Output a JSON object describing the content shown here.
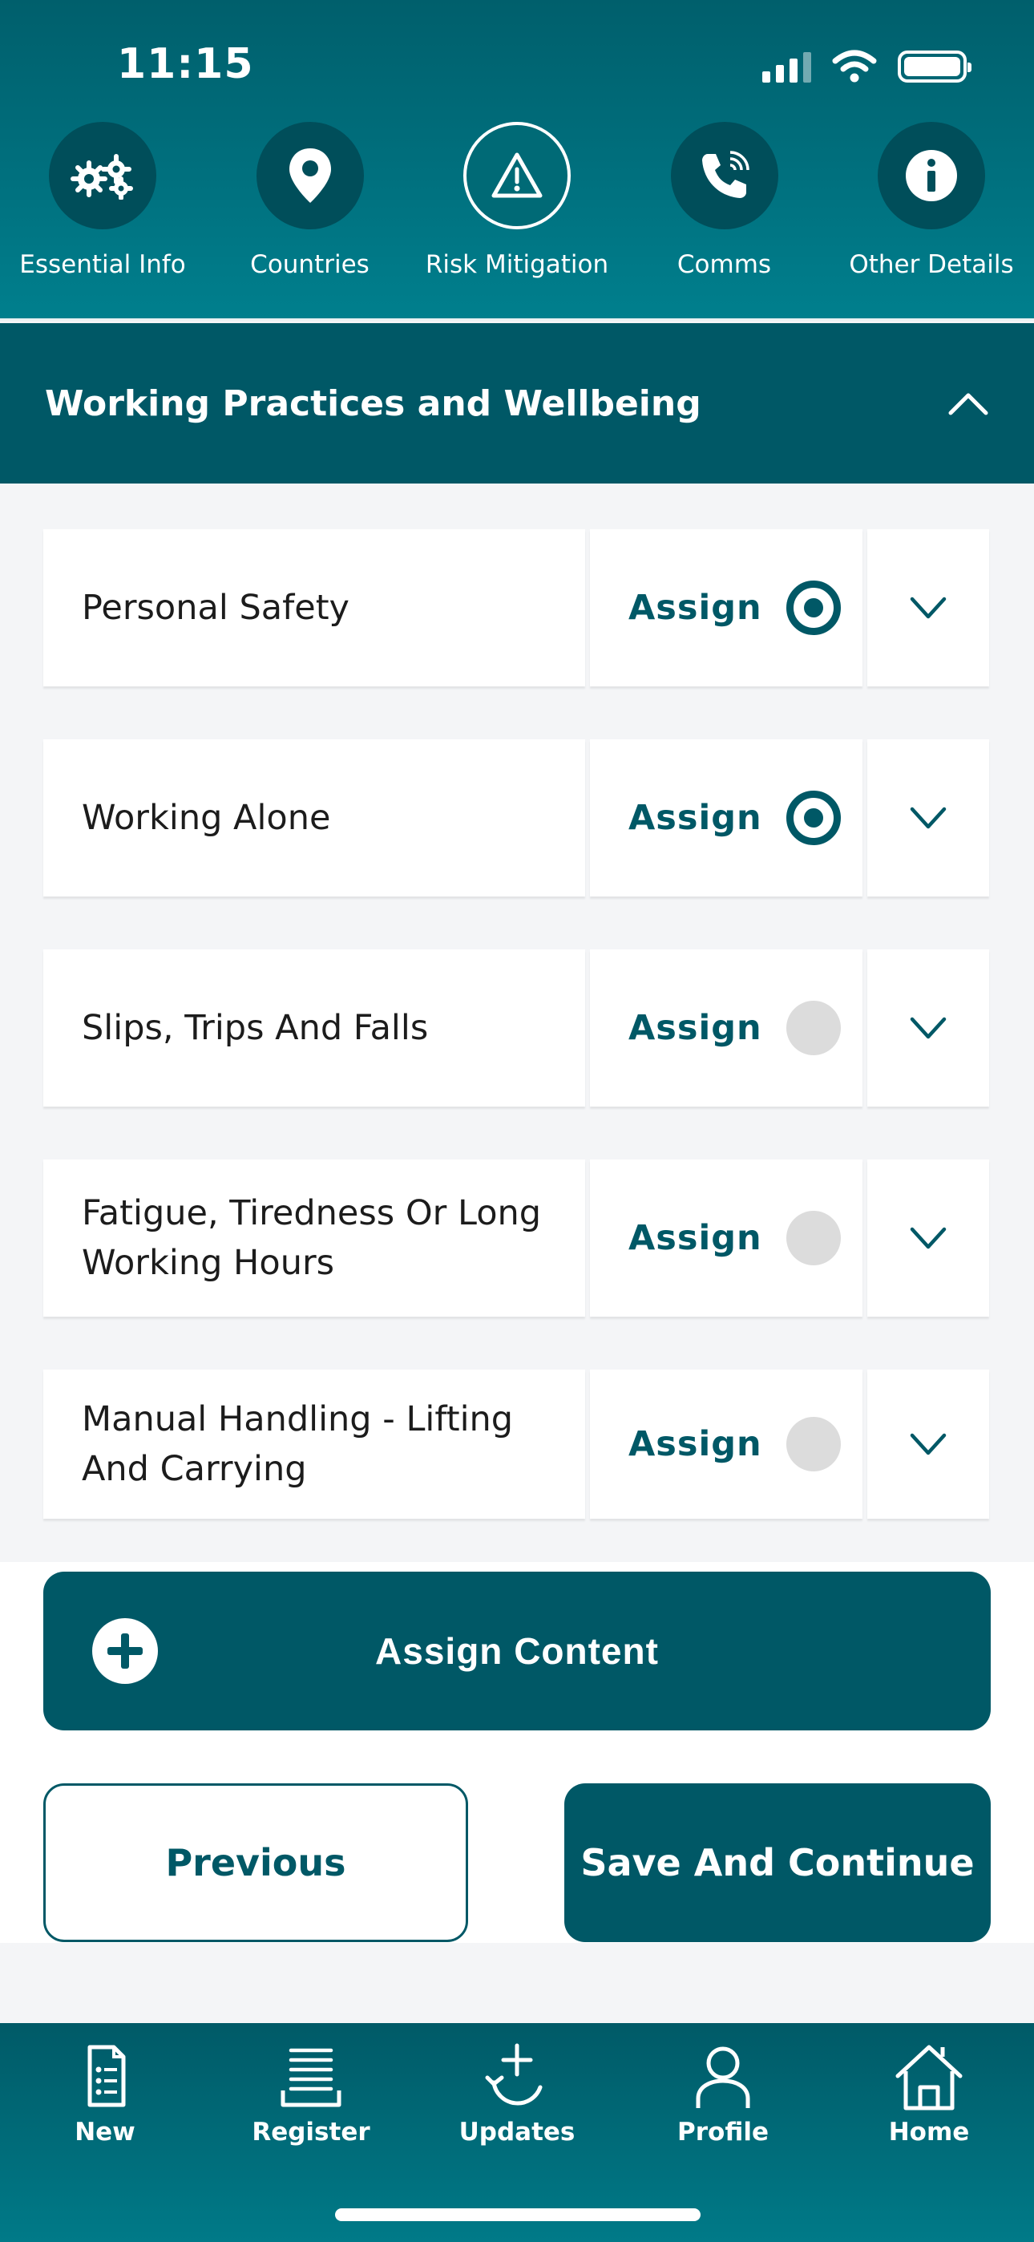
{
  "status_bar": {
    "time": "11:15"
  },
  "steps": [
    {
      "label": "Essential Info",
      "icon": "gears-icon",
      "active": false
    },
    {
      "label": "Countries",
      "icon": "location-pin-icon",
      "active": false
    },
    {
      "label": "Risk Mitigation",
      "icon": "warning-icon",
      "active": true
    },
    {
      "label": "Comms",
      "icon": "phone-icon",
      "active": false
    },
    {
      "label": "Other Details",
      "icon": "info-icon",
      "active": false
    }
  ],
  "section": {
    "title": "Working Practices and Wellbeing",
    "expanded": true
  },
  "items": [
    {
      "title": "Personal Safety",
      "assign_label": "Assign",
      "selected": true
    },
    {
      "title": "Working Alone",
      "assign_label": "Assign",
      "selected": true
    },
    {
      "title": "Slips, Trips And Falls",
      "assign_label": "Assign",
      "selected": false
    },
    {
      "title": "Fatigue, Tiredness Or Long Working Hours",
      "assign_label": "Assign",
      "selected": false
    },
    {
      "title": "Manual Handling - Lifting And Carrying",
      "assign_label": "Assign",
      "selected": false
    }
  ],
  "actions": {
    "assign_content": "Assign Content",
    "previous": "Previous",
    "save_continue": "Save And Continue"
  },
  "tabbar": [
    {
      "label": "New",
      "icon": "document-icon"
    },
    {
      "label": "Register",
      "icon": "register-icon"
    },
    {
      "label": "Updates",
      "icon": "updates-icon"
    },
    {
      "label": "Profile",
      "icon": "profile-icon"
    },
    {
      "label": "Home",
      "icon": "home-icon"
    }
  ],
  "colors": {
    "primary": "#005866",
    "header_gradient_top": "#005f6c",
    "unselected_radio": "#dcdcdc",
    "background": "#f4f5f7"
  }
}
